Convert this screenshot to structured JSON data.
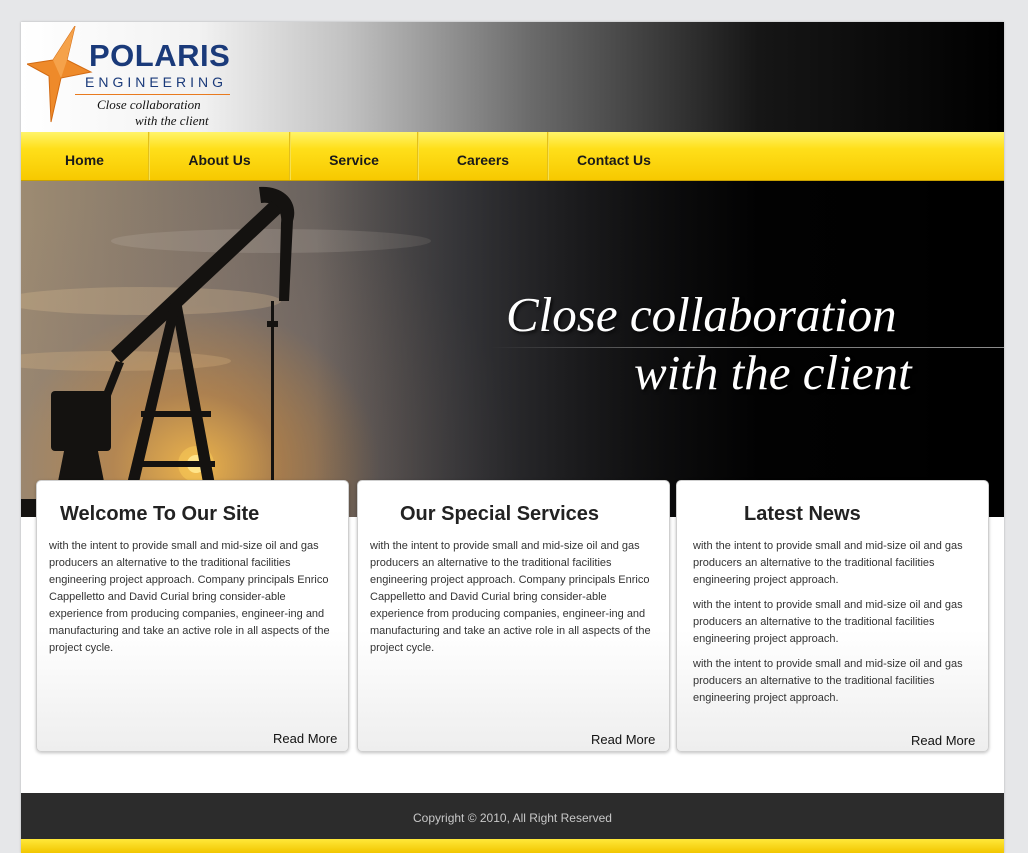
{
  "header": {
    "logo_name": "POLARIS",
    "logo_sub": "ENGINEERING",
    "logo_tagline_1": "Close collaboration",
    "logo_tagline_2": "with the client",
    "logo_icon": "star-icon"
  },
  "nav": {
    "items": [
      {
        "label": "Home"
      },
      {
        "label": "About Us"
      },
      {
        "label": "Service"
      },
      {
        "label": "Careers"
      },
      {
        "label": "Contact Us"
      }
    ]
  },
  "banner": {
    "line_1": "Close collaboration",
    "line_2": "with the client"
  },
  "boxes": [
    {
      "title": "Welcome To Our Site",
      "paragraphs": [
        "with the intent to provide small and mid-size oil and gas producers an alternative to the traditional facilities engineering project approach. Company principals Enrico Cappelletto and David Curial bring consider-able experience from producing companies, engineer-ing and manufacturing and take an active role in all aspects of the project cycle."
      ],
      "read_more": "Read More"
    },
    {
      "title": "Our Special Services",
      "paragraphs": [
        "with the intent to provide small and mid-size oil and gas producers an alternative to the traditional facilities engineering project approach. Company principals Enrico Cappelletto and David Curial bring consider-able experience from producing companies, engineer-ing and manufacturing and take an active role in all aspects of the project cycle."
      ],
      "read_more": "Read More"
    },
    {
      "title": "Latest News",
      "paragraphs": [
        "with the intent to provide small and mid-size oil and gas producers an alternative to the traditional facilities engineering project approach.",
        "with the intent to provide small and mid-size oil and gas producers an alternative to the traditional facilities engineering project approach.",
        "with the intent to provide small and mid-size oil and gas producers an alternative to the traditional facilities engineering project approach."
      ],
      "read_more": "Read More"
    }
  ],
  "footer": {
    "copyright": "Copyright © 2010, All Right Reserved"
  },
  "colors": {
    "brand_blue": "#1a3a7a",
    "accent_orange": "#e87a1f",
    "nav_yellow": "#ffdf1a",
    "footer_dark": "#2c2c2c"
  }
}
